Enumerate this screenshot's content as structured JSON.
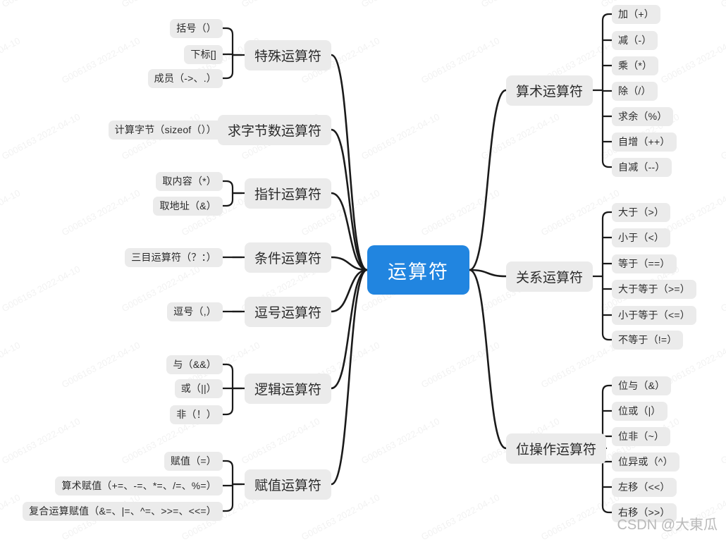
{
  "mindmap": {
    "root": {
      "label": "运算符"
    },
    "left_branches": [
      {
        "label": "特殊运算符",
        "children": [
          {
            "label": "括号（）"
          },
          {
            "label": "下标[]"
          },
          {
            "label": "成员（->、.）"
          }
        ]
      },
      {
        "label": "求字节数运算符",
        "children": [
          {
            "label": "计算字节（sizeof（））"
          }
        ]
      },
      {
        "label": "指针运算符",
        "children": [
          {
            "label": "取内容（*）"
          },
          {
            "label": "取地址（&）"
          }
        ]
      },
      {
        "label": "条件运算符",
        "children": [
          {
            "label": "三目运算符（？：）"
          }
        ]
      },
      {
        "label": "逗号运算符",
        "children": [
          {
            "label": "逗号（,）"
          }
        ]
      },
      {
        "label": "逻辑运算符",
        "children": [
          {
            "label": "与（&&）"
          },
          {
            "label": "或（||）"
          },
          {
            "label": "非（！）"
          }
        ]
      },
      {
        "label": "赋值运算符",
        "children": [
          {
            "label": "赋值（=）"
          },
          {
            "label": "算术赋值（+=、-=、*=、/=、%=）"
          },
          {
            "label": "复合运算赋值（&=、|=、^=、>>=、<<=）"
          }
        ]
      }
    ],
    "right_branches": [
      {
        "label": "算术运算符",
        "children": [
          {
            "label": "加（+）"
          },
          {
            "label": "减（-）"
          },
          {
            "label": "乘（*）"
          },
          {
            "label": "除（/）"
          },
          {
            "label": "求余（%）"
          },
          {
            "label": "自增（++）"
          },
          {
            "label": "自减（--）"
          }
        ]
      },
      {
        "label": "关系运算符",
        "children": [
          {
            "label": "大于（>）"
          },
          {
            "label": "小于（<）"
          },
          {
            "label": "等于（==）"
          },
          {
            "label": "大于等于（>=）"
          },
          {
            "label": "小于等于（<=）"
          },
          {
            "label": "不等于（!=）"
          }
        ]
      },
      {
        "label": "位操作运算符",
        "children": [
          {
            "label": "位与（&）"
          },
          {
            "label": "位或（|）"
          },
          {
            "label": "位非（~）"
          },
          {
            "label": "位异或（^）"
          },
          {
            "label": "左移（<<）"
          },
          {
            "label": "右移（>>）"
          }
        ]
      }
    ]
  },
  "watermark": {
    "tile_text": "G006163 2022-04-10",
    "signature": "CSDN @大東瓜"
  },
  "colors": {
    "root_fill": "#2185e0",
    "root_text": "#ffffff",
    "node_fill": "#ebebeb",
    "node_text": "#2b2b2b",
    "link": "#1a1a1a",
    "watermark": "#f2f2f2",
    "signature": "#b9b9b9",
    "background": "#ffffff"
  }
}
